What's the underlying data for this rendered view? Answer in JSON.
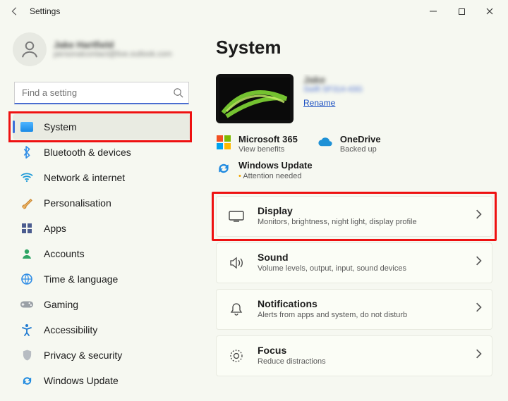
{
  "window": {
    "title": "Settings"
  },
  "user": {
    "name": "Jake Hartfield",
    "email": "personalcontact@live.outlook.com"
  },
  "search": {
    "placeholder": "Find a setting"
  },
  "sidebar": {
    "items": [
      {
        "label": "System",
        "icon": "system-icon"
      },
      {
        "label": "Bluetooth & devices",
        "icon": "bluetooth-icon"
      },
      {
        "label": "Network & internet",
        "icon": "wifi-icon"
      },
      {
        "label": "Personalisation",
        "icon": "brush-icon"
      },
      {
        "label": "Apps",
        "icon": "apps-icon"
      },
      {
        "label": "Accounts",
        "icon": "person-icon"
      },
      {
        "label": "Time & language",
        "icon": "globe-clock-icon"
      },
      {
        "label": "Gaming",
        "icon": "gamepad-icon"
      },
      {
        "label": "Accessibility",
        "icon": "accessibility-icon"
      },
      {
        "label": "Privacy & security",
        "icon": "shield-icon"
      },
      {
        "label": "Windows Update",
        "icon": "update-icon"
      }
    ],
    "active_index": 0
  },
  "page": {
    "title": "System",
    "device": {
      "name": "Jake",
      "model": "Swift SF314-43G",
      "rename": "Rename"
    }
  },
  "status": {
    "ms365": {
      "title": "Microsoft 365",
      "subtitle": "View benefits"
    },
    "onedrive": {
      "title": "OneDrive",
      "subtitle": "Backed up"
    },
    "update": {
      "title": "Windows Update",
      "subtitle": "Attention needed"
    }
  },
  "cards": [
    {
      "icon": "display-icon",
      "title": "Display",
      "subtitle": "Monitors, brightness, night light, display profile"
    },
    {
      "icon": "sound-icon",
      "title": "Sound",
      "subtitle": "Volume levels, output, input, sound devices"
    },
    {
      "icon": "notifications-icon",
      "title": "Notifications",
      "subtitle": "Alerts from apps and system, do not disturb"
    },
    {
      "icon": "focus-icon",
      "title": "Focus",
      "subtitle": "Reduce distractions"
    }
  ],
  "colors": {
    "accent": "#3b6fd9",
    "highlight": "#e11"
  }
}
